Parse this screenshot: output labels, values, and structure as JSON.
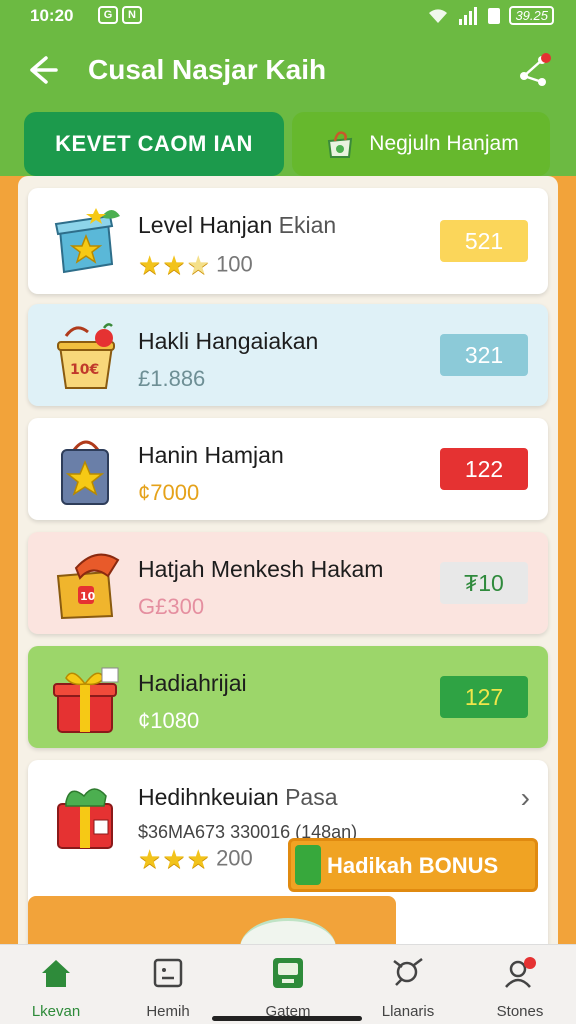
{
  "status_bar": {
    "time": "10:20",
    "notif_1": "G",
    "notif_2": "N",
    "battery": "39.25"
  },
  "app_bar": {
    "title": "Cusal Nasjar Kaih",
    "back_icon": "arrow-left-icon",
    "share_icon": "share-icon"
  },
  "tabs": [
    {
      "label": "KEVET CAOM IAN"
    },
    {
      "label": "Negjuln Hanjam",
      "icon": "shopping-bag-icon"
    }
  ],
  "items": [
    {
      "name": "Level Hanjan",
      "extra": "Ekian",
      "rating_text": "100",
      "stars": 2.5,
      "badge": "521",
      "icon": "gift-box-icon",
      "bg": "#ffffff",
      "badge_bg": "#fbd65a",
      "badge_fg": "#ffffff"
    },
    {
      "name": "Hakli Hangaiakan",
      "sub": "£1.886",
      "badge": "321",
      "icon": "shopping-basket-icon",
      "bg": "#dff1f7",
      "badge_bg": "#8ccad8",
      "badge_fg": "#ffffff",
      "sub_color": "#6e8f95"
    },
    {
      "name": "Hanin Hamjan",
      "sub": "¢7000",
      "badge": "122",
      "icon": "shopping-bag-icon",
      "bg": "#ffffff",
      "badge_bg": "#e53232",
      "badge_fg": "#ffffff",
      "sub_color": "#e5a21a"
    },
    {
      "name": "Hatjah Menkesh Hakam",
      "sub": "G£300",
      "badge": "₮10",
      "icon": "treasure-chest-icon",
      "bg": "#fbe4df",
      "badge_bg": "#e8e8e8",
      "badge_fg": "#2f8a3c",
      "sub_color": "#e58fa0"
    },
    {
      "name": "Hadiahrijai",
      "sub": "¢1080",
      "badge": "127",
      "icon": "gift-icon",
      "bg": "#9cd66a",
      "badge_bg": "#2fa344",
      "badge_fg": "#f1e64a",
      "sub_color": "#ffffff"
    },
    {
      "name": "Hedihnkeuian",
      "extra": "Pasa",
      "sub": "$36MA673 330016 (148an)",
      "rating_text": "200",
      "stars": 3,
      "icon": "present-box-icon",
      "bg": "#ffffff",
      "bonus_label": "Hadikah BONUS",
      "chevron_icon": "chevron-right-icon",
      "sub_color": "#444444"
    }
  ],
  "bottom_nav": [
    {
      "label": "Lkevan",
      "icon": "home-icon",
      "active": true
    },
    {
      "label": "Hemih",
      "icon": "face-icon"
    },
    {
      "label": "Gatem",
      "icon": "device-icon"
    },
    {
      "label": "Llanaris",
      "icon": "tools-icon"
    },
    {
      "label": "Stones",
      "icon": "profile-icon"
    }
  ]
}
